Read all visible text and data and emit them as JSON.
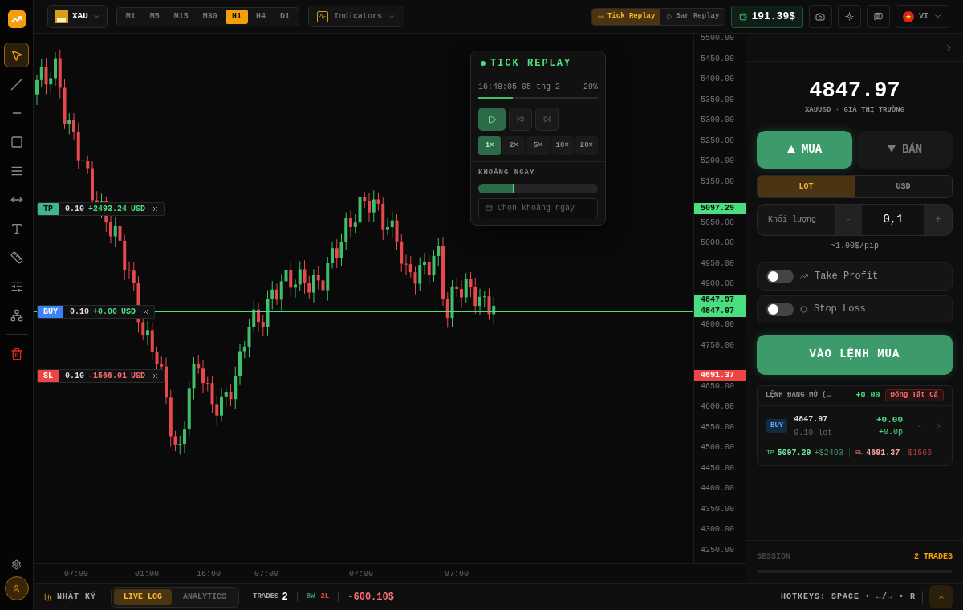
{
  "tools": [
    {
      "kind": "cursor",
      "selected": true
    },
    {
      "kind": "trendline",
      "selected": false
    },
    {
      "kind": "hline",
      "selected": false
    },
    {
      "kind": "rectangle",
      "selected": false
    },
    {
      "kind": "fib",
      "selected": false
    },
    {
      "kind": "range",
      "selected": false
    },
    {
      "kind": "text",
      "selected": false
    },
    {
      "kind": "ruler",
      "selected": false
    },
    {
      "kind": "pattern",
      "selected": false
    },
    {
      "kind": "network",
      "selected": false
    },
    {
      "kind": "trash",
      "selected": false
    }
  ],
  "symbol": {
    "label": "XAU"
  },
  "timeframes": [
    {
      "label": "M1",
      "selected": false
    },
    {
      "label": "M5",
      "selected": false
    },
    {
      "label": "M15",
      "selected": false
    },
    {
      "label": "M30",
      "selected": false
    },
    {
      "label": "H1",
      "selected": true
    },
    {
      "label": "H4",
      "selected": false
    },
    {
      "label": "D1",
      "selected": false
    }
  ],
  "indicators": {
    "label": "Indicators"
  },
  "replay_modes": [
    {
      "label": "Tick Replay",
      "selected": true
    },
    {
      "label": "Bar Replay",
      "selected": false
    }
  ],
  "balance": "191.39$",
  "language": "VI",
  "price_axis": [
    "5500.00",
    "5450.00",
    "5400.00",
    "5350.00",
    "5300.00",
    "5250.00",
    "5200.00",
    "5150.00",
    "5050.00",
    "5000.00",
    "4950.00",
    "4900.00",
    "4800.00",
    "4750.00",
    "4650.00",
    "4600.00",
    "4550.00",
    "4500.00",
    "4450.00",
    "4400.00",
    "4350.00",
    "4300.00",
    "4250.00"
  ],
  "current_price": "4847.97",
  "time_axis": [
    "07:00",
    "01:00",
    "16:00",
    "07:00",
    "07:00",
    "07:00"
  ],
  "order_lines": [
    {
      "kind": "tp",
      "tag": "TP",
      "lot": "0.10",
      "pnl": "+2493.24",
      "currency": "USD",
      "price": "5097.29"
    },
    {
      "kind": "buy",
      "tag": "BUY",
      "lot": "0.10",
      "pnl": "+0.00",
      "currency": "USD",
      "price": "4847.97"
    },
    {
      "kind": "sl",
      "tag": "SL",
      "lot": "0.10",
      "pnl": "-1566.01",
      "currency": "USD",
      "price": "4691.37"
    }
  ],
  "tick_replay": {
    "title": "TICK REPLAY",
    "time": "16:48:05 05 thg 2",
    "percent": "29%",
    "level": 0.29,
    "speeds": [
      {
        "label": "1×",
        "selected": true
      },
      {
        "label": "2×",
        "selected": false
      },
      {
        "label": "5×",
        "selected": false
      },
      {
        "label": "10×",
        "selected": false
      },
      {
        "label": "20×",
        "selected": false
      }
    ],
    "range_label": "KHOẢNG NGÀY",
    "range": {
      "level": 0.3
    },
    "date_placeholder": "Chọn khoảng ngày"
  },
  "panel": {
    "price": "4847.97",
    "subtitle": "XAUUSD · GIÁ THỊ TRƯỜNG",
    "sides": [
      {
        "kind": "buy",
        "label": "MUA",
        "selected": true
      },
      {
        "kind": "sell",
        "label": "BÁN",
        "selected": false
      }
    ],
    "units": [
      {
        "label": "LOT",
        "selected": true
      },
      {
        "label": "USD",
        "selected": false
      }
    ],
    "volume": {
      "label": "Khối lượng",
      "value": "0,1",
      "minus": "-",
      "plus": "+"
    },
    "pip": "~1.00$/pip",
    "toggles": [
      {
        "kind": "tp",
        "label": "Take Profit",
        "on": false
      },
      {
        "kind": "sl",
        "label": "Stop Loss",
        "on": false
      }
    ],
    "submit": "VÀO LỆNH MUA",
    "open_orders": {
      "title": "LỆNH ĐANG MỞ (…",
      "pnl": "+0.00",
      "close_all": "Đóng Tất Cả",
      "orders": [
        {
          "side": "BUY",
          "price": "4847.97",
          "lot": "0.10 lot",
          "pnl": "+0.00",
          "pips": "+0.0p",
          "tp_label": "TP",
          "tp": "5097.29",
          "tp_pnl": "+$2493",
          "sl_label": "SL",
          "sl": "4691.37",
          "sl_pnl": "-$1566"
        }
      ]
    },
    "session": {
      "label": "SESSION",
      "trades": "2 TRADES"
    }
  },
  "bottom": {
    "journal": "NHẬT KÝ",
    "tabs": [
      {
        "label": "LIVE LOG",
        "selected": true
      },
      {
        "label": "ANALYTICS",
        "selected": false
      }
    ],
    "trades_label": "TRADES",
    "trades": "2",
    "wins": "0W",
    "losses": "2L",
    "pnl": "-600.10$",
    "hotkeys": "HOTKEYS: SPACE • ←/→ • R"
  }
}
